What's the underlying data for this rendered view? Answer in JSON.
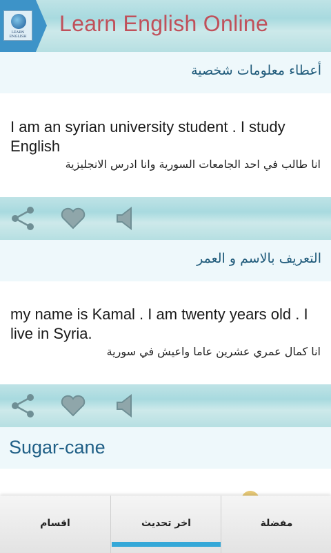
{
  "app": {
    "title": "Learn English Online",
    "logo_text": "LEARN ENGLISH"
  },
  "entries": [
    {
      "heading": "أعطاء معلومات شخصية",
      "english": "I am an syrian university student . I study English",
      "arabic": "انا طالب في احد الجامعات السورية وانا ادرس الانجليزية"
    },
    {
      "heading": "التعريف بالاسم و العمر",
      "english": "my name is Kamal . I am twenty years old . I live in Syria.",
      "arabic": "انا كمال عمري عشرين عاما واعيش في سورية"
    }
  ],
  "actions": {
    "share": "share-icon",
    "favorite": "heart-icon",
    "audio": "speaker-icon"
  },
  "next_category": "Sugar-cane",
  "nav": {
    "tabs": [
      "اقسام",
      "اخر تحديث",
      "مفضلة"
    ],
    "selected": "اخر تحديث"
  },
  "colors": {
    "title": "#c0505a",
    "tab_accent": "#3d93c8",
    "nav_indicator": "#35a8d8",
    "heading_text": "#1f5a7a"
  }
}
